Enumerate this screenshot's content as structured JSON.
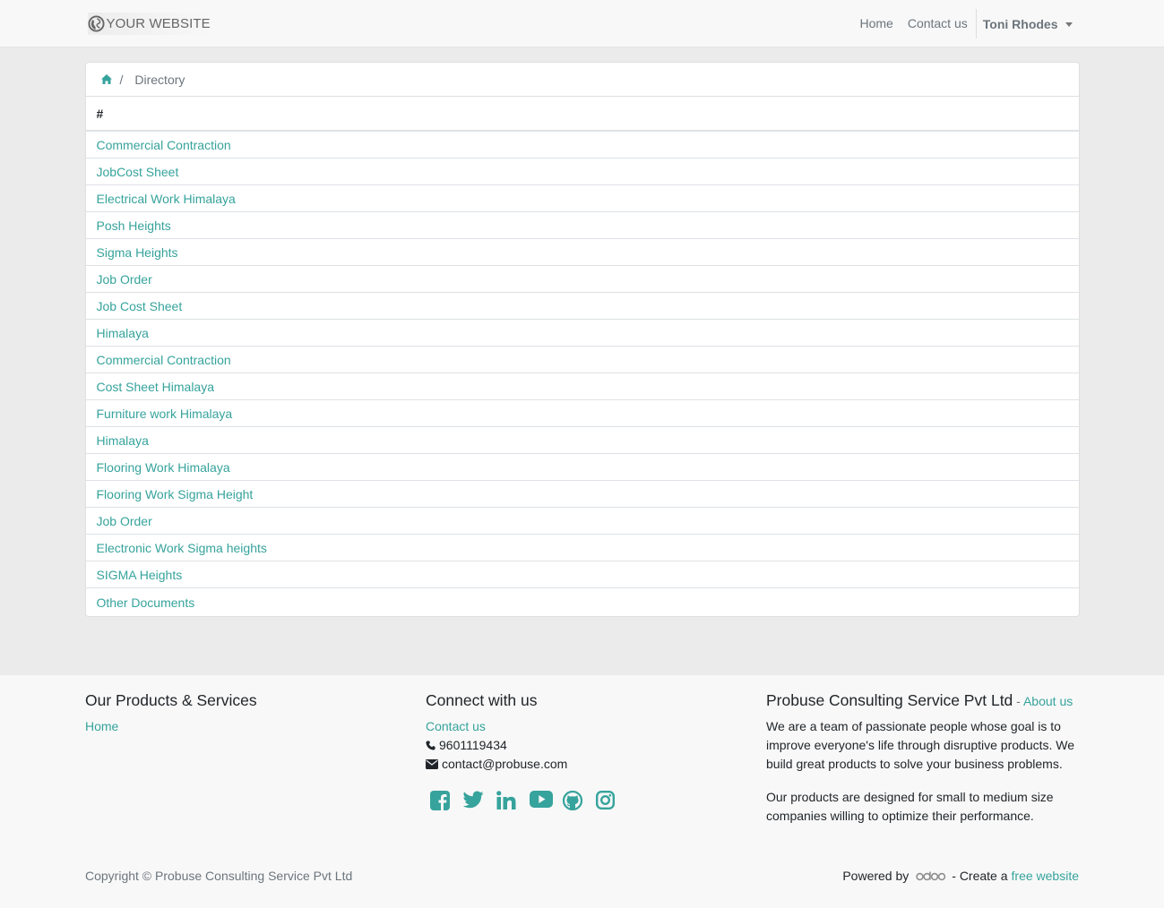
{
  "navbar": {
    "brand": "YOUR WEBSITE",
    "links": [
      "Home",
      "Contact us"
    ],
    "user": "Toni Rhodes"
  },
  "breadcrumb": {
    "separator": "/",
    "current": "Directory"
  },
  "table": {
    "header": "#",
    "rows": [
      "Commercial Contraction",
      "JobCost Sheet",
      "Electrical Work Himalaya",
      "Posh Heights",
      "Sigma Heights",
      "Job Order",
      "Job Cost Sheet",
      "Himalaya",
      "Commercial Contraction",
      "Cost Sheet Himalaya",
      "Furniture work Himalaya",
      "Himalaya",
      "Flooring Work Himalaya",
      "Flooring Work Sigma Height",
      "Job Order",
      "Electronic Work Sigma heights",
      "SIGMA Heights",
      "Other Documents"
    ]
  },
  "footer": {
    "products": {
      "title": "Our Products & Services",
      "link": "Home"
    },
    "connect": {
      "title": "Connect with us",
      "link": "Contact us",
      "phone": "9601119434",
      "email": "contact@probuse.com"
    },
    "about": {
      "title": "Probuse Consulting Service Pvt Ltd",
      "dash": " - ",
      "link": "About us",
      "p1": "We are a team of passionate people whose goal is to improve everyone's life through disruptive products. We build great products to solve your business problems.",
      "p2": "Our products are designed for small to medium size companies willing to optimize their performance."
    },
    "copyright": "Copyright © Probuse Consulting Service Pvt Ltd",
    "powered_by": "Powered by",
    "create_text": "- Create a",
    "free_website": "free website"
  },
  "colors": {
    "accent": "#36a39c",
    "muted": "#6c757d",
    "background": "#ebebeb"
  },
  "icons": [
    "globe-icon",
    "home-icon",
    "phone-icon",
    "envelope-icon",
    "facebook-icon",
    "twitter-icon",
    "linkedin-icon",
    "youtube-icon",
    "github-icon",
    "instagram-icon",
    "odoo-logo"
  ]
}
